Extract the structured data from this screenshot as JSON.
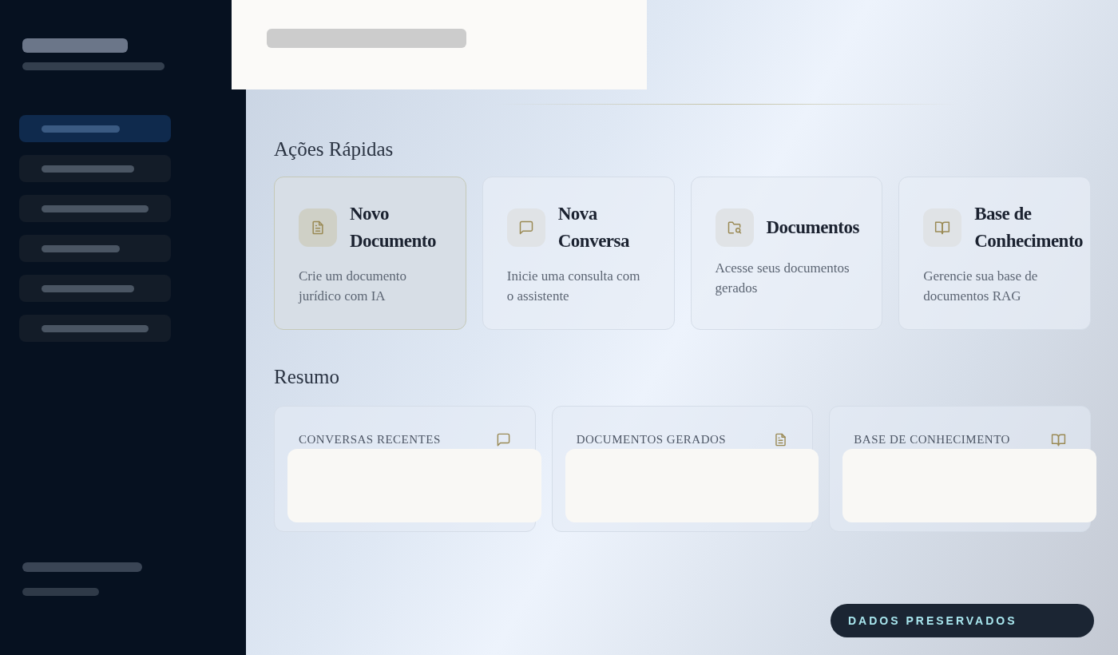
{
  "sidebar": {
    "items": [
      {
        "selected": true
      },
      {
        "selected": false
      },
      {
        "selected": false
      },
      {
        "selected": false
      },
      {
        "selected": false
      },
      {
        "selected": false
      }
    ]
  },
  "quick_actions": {
    "title": "Ações Rápidas",
    "cards": [
      {
        "title": "Novo Documento",
        "description": "Crie um documento jurídico com IA",
        "selected": true
      },
      {
        "title": "Nova Conversa",
        "description": "Inicie uma consulta com o assistente",
        "selected": false
      },
      {
        "title": "Documentos",
        "description": "Acesse seus documentos gerados",
        "selected": false
      },
      {
        "title": "Base de Conhecimento",
        "description": "Gerencie sua base de documentos RAG",
        "selected": false
      }
    ]
  },
  "summary": {
    "title": "Resumo",
    "cards": [
      {
        "label": "CONVERSAS RECENTES"
      },
      {
        "label": "DOCUMENTOS GERADOS"
      },
      {
        "label": "BASE DE CONHECIMENTO"
      }
    ]
  },
  "badge": "DADOS PRESERVADOS"
}
